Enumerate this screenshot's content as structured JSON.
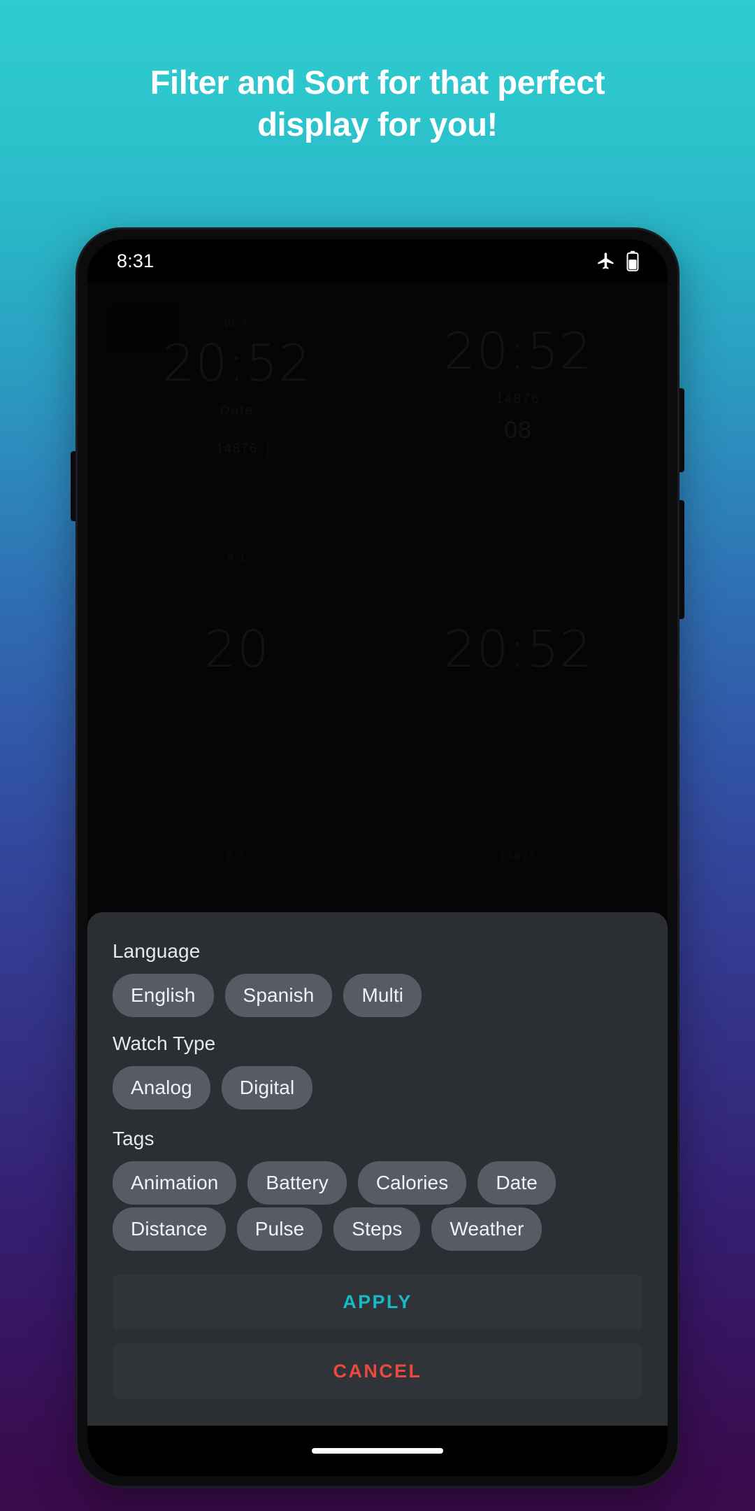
{
  "promo": {
    "headline_line1": "Filter and Sort for that perfect",
    "headline_line2": "display for you!"
  },
  "colors": {
    "bg_top": "#2fcbd0",
    "bg_bottom": "#3a0a4a",
    "sheet_bg": "#2b2e33",
    "chip_bg": "#565b66",
    "apply_accent": "#19b9c6",
    "cancel_accent": "#ea4a3d"
  },
  "status_bar": {
    "time": "8:31",
    "airplane_icon": "airplane-mode-icon",
    "battery_icon": "battery-icon"
  },
  "background_grid": {
    "cards": [
      {
        "top_row": "W  T",
        "time": "20:52",
        "sub": "Date",
        "badge": "14876",
        "metric": "",
        "foot": "8       1"
      },
      {
        "top_row": "",
        "time": "20:52",
        "sub": "14876",
        "badge": "",
        "metric": "08",
        "foot": ""
      },
      {
        "top_row": "",
        "time": "20",
        "sub": "",
        "badge": "",
        "metric": "",
        "foot": "8      1"
      },
      {
        "top_row": "",
        "time": "20:52",
        "sub": "",
        "badge": "",
        "metric": "",
        "foot": "14876"
      }
    ]
  },
  "filter_sheet": {
    "sections": [
      {
        "label": "Language",
        "chips": [
          "English",
          "Spanish",
          "Multi"
        ]
      },
      {
        "label": "Watch Type",
        "chips": [
          "Analog",
          "Digital"
        ]
      },
      {
        "label": "Tags",
        "chips_row1": [
          "Animation",
          "Battery",
          "Calories",
          "Date"
        ],
        "chips_row2": [
          "Distance",
          "Pulse",
          "Steps",
          "Weather"
        ]
      }
    ],
    "apply_label": "APPLY",
    "cancel_label": "CANCEL"
  }
}
